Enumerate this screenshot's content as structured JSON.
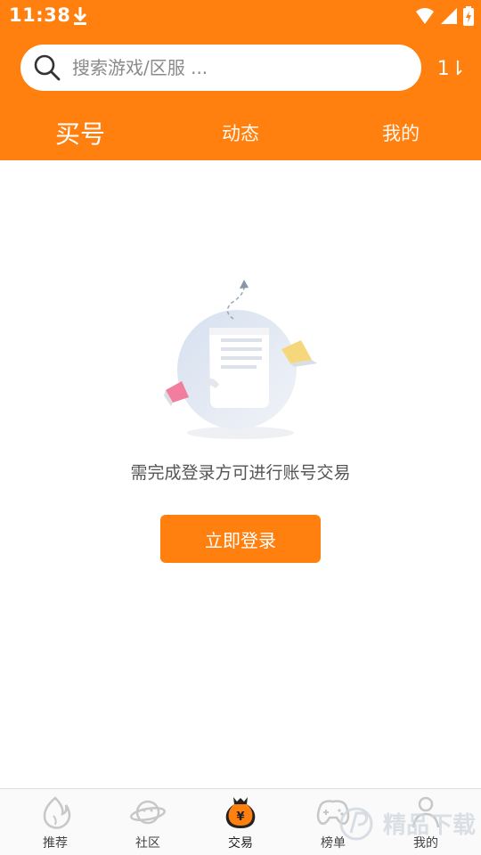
{
  "status_bar": {
    "time": "11:38",
    "icons": [
      "download-icon",
      "wifi-icon",
      "signal-icon",
      "battery-icon"
    ]
  },
  "search": {
    "placeholder": "搜索游戏/区服 ...",
    "value": "",
    "sort_label": "1⇂"
  },
  "tabs": [
    {
      "label": "买号",
      "active": true
    },
    {
      "label": "动态",
      "active": false
    },
    {
      "label": "我的",
      "active": false
    }
  ],
  "empty_state": {
    "message": "需完成登录方可进行账号交易",
    "login_button": "立即登录"
  },
  "bottom_nav": [
    {
      "label": "推荐",
      "icon": "flame-icon",
      "active": false
    },
    {
      "label": "社区",
      "icon": "planet-icon",
      "active": false
    },
    {
      "label": "交易",
      "icon": "money-bag-icon",
      "active": true
    },
    {
      "label": "榜单",
      "icon": "gamepad-icon",
      "active": false
    },
    {
      "label": "我的",
      "icon": "person-icon",
      "active": false
    }
  ],
  "watermark": {
    "text": "精品下载"
  },
  "colors": {
    "brand_orange": "#FF7F0F",
    "text_gray": "#555555",
    "nav_bg": "#FAFAFA"
  }
}
